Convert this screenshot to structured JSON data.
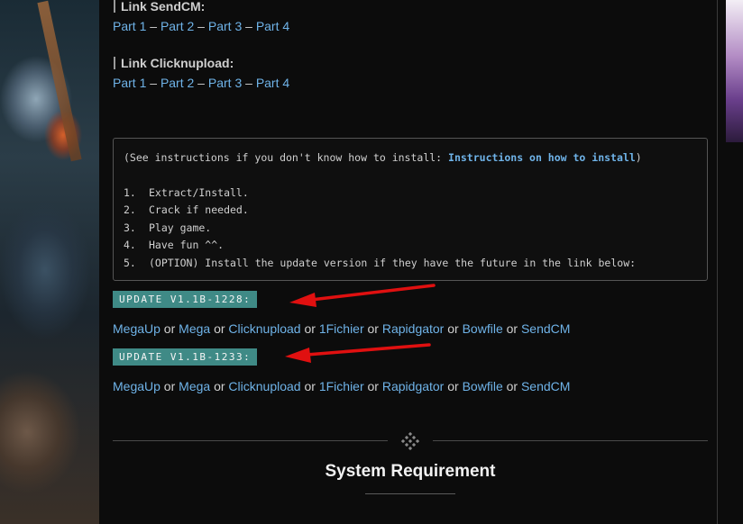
{
  "sections": [
    {
      "heading": "Link SendCM:",
      "parts": [
        "Part 1",
        "Part 2",
        "Part 3",
        "Part 4"
      ]
    },
    {
      "heading": "Link Clicknupload:",
      "parts": [
        "Part 1",
        "Part 2",
        "Part 3",
        "Part 4"
      ]
    }
  ],
  "part_separator": " – ",
  "instructions": {
    "intro_prefix": "(See instructions if you don't know how to install: ",
    "intro_link": "Instructions on how to install",
    "intro_suffix": ")",
    "steps": [
      {
        "num": "1.",
        "text": "Extract/Install."
      },
      {
        "num": "2.",
        "text": "Crack if needed."
      },
      {
        "num": "3.",
        "text": "Play game."
      },
      {
        "num": "4.",
        "text": "Have fun ^^."
      },
      {
        "num": "5.",
        "text": "(OPTION) Install the update version if they have the future in the link below:"
      }
    ]
  },
  "updates": [
    {
      "label": "UPDATE V1.1B-1228:"
    },
    {
      "label": "UPDATE V1.1B-1233:"
    }
  ],
  "mirrors": [
    "MegaUp",
    "Mega",
    "Clicknupload",
    "1Fichier",
    "Rapidgator",
    "Bowfile",
    "SendCM"
  ],
  "or_word": " or ",
  "system_requirement": "System Requirement",
  "colors": {
    "link": "#6fb3e8",
    "badge": "#3f8a86",
    "arrow": "#e01010"
  }
}
